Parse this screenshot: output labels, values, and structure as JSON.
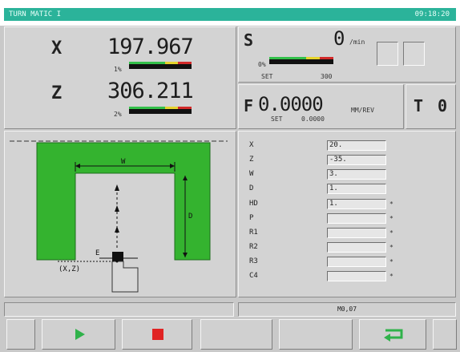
{
  "title_bar": {
    "left": "TURN MATIC I",
    "right": "09:18:20"
  },
  "axes": [
    {
      "name": "X",
      "value": "197.967",
      "load_label": "1%"
    },
    {
      "name": "Z",
      "value": "306.211",
      "load_label": "2%"
    }
  ],
  "spindle": {
    "label": "S",
    "value": "0",
    "unit": "/min",
    "load_label": "0%",
    "set_label": "SET",
    "set_value": "300"
  },
  "feed": {
    "label": "F",
    "value": "0.0000",
    "unit": "MM/REV",
    "set_label": "SET",
    "set_value": "0.0000"
  },
  "tool": {
    "label": "T",
    "value": "0"
  },
  "diagram": {
    "w_label": "W",
    "d_label": "D",
    "e_label": "E",
    "origin_label": "(X,Z)"
  },
  "params": [
    {
      "label": "X",
      "value": "20."
    },
    {
      "label": "Z",
      "value": "-35."
    },
    {
      "label": "W",
      "value": "3."
    },
    {
      "label": "D",
      "value": "1."
    },
    {
      "label": "HD",
      "value": "1.",
      "mark": "*"
    },
    {
      "label": "P",
      "value": "",
      "mark": "*"
    },
    {
      "label": "R1",
      "value": "",
      "mark": "*"
    },
    {
      "label": "R2",
      "value": "",
      "mark": "*"
    },
    {
      "label": "R3",
      "value": "",
      "mark": "*"
    },
    {
      "label": "C4",
      "value": "",
      "mark": "*"
    }
  ],
  "status": {
    "right_text": "M0,07"
  },
  "colors": {
    "title_bar": "#2bb39a",
    "workpiece": "#34b32f",
    "play": "#2fb24a",
    "stop": "#e02323"
  },
  "softkeys": [
    "blank",
    "play-icon",
    "stop-icon",
    "blank",
    "blank",
    "return-icon",
    "blank"
  ]
}
